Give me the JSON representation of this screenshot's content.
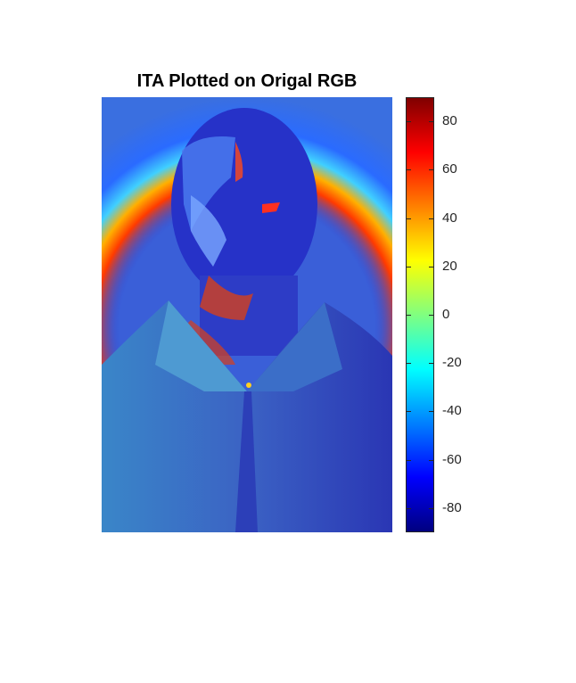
{
  "figure": {
    "title": "ITA Plotted on Origal RGB",
    "colormap": "jet",
    "colors": {
      "background": "#ffffff",
      "frame": "#262626"
    },
    "colorbar": {
      "range": [
        -90,
        90
      ],
      "ticks": [
        80,
        60,
        40,
        20,
        0,
        -20,
        -40,
        -60,
        -80
      ],
      "tick_labels": [
        "80",
        "60",
        "40",
        "20",
        "0",
        "-20",
        "-40",
        "-60",
        "-80"
      ]
    }
  }
}
